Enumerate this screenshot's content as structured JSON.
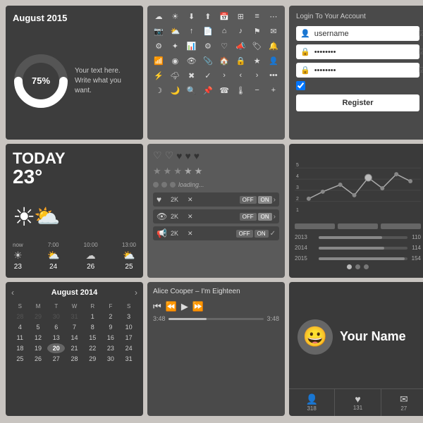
{
  "panel1": {
    "title": "August 2015",
    "donut_percent": 75,
    "donut_label": "75%",
    "sub_text": "Your text here.\nWrite what you want."
  },
  "panel3": {
    "title": "Login To Your Account",
    "username_placeholder": "username",
    "password_placeholder": "········",
    "password2_placeholder": "········",
    "register_label": "Register"
  },
  "panel4": {
    "today_label": "TODAY",
    "temp": "23°",
    "forecast": [
      {
        "time": "now",
        "temp": "23"
      },
      {
        "time": "7:00",
        "temp": "24"
      },
      {
        "time": "10:00",
        "temp": "26"
      },
      {
        "time": "13:00",
        "temp": "25"
      }
    ]
  },
  "panel6": {
    "chart_years": [
      "2013",
      "2014",
      "2015"
    ],
    "chart_vals": [
      110,
      114,
      154
    ],
    "chart_max": 160
  },
  "panel7": {
    "month_label": "August 2014",
    "days_header": [
      "S",
      "M",
      "T",
      "W",
      "R",
      "F",
      "S"
    ],
    "weeks": [
      [
        "28",
        "29",
        "30",
        "31",
        "1",
        "2",
        "3"
      ],
      [
        "4",
        "5",
        "6",
        "7",
        "8",
        "9",
        "10"
      ],
      [
        "11",
        "12",
        "13",
        "14",
        "15",
        "16",
        "17"
      ],
      [
        "18",
        "19",
        "20",
        "21",
        "22",
        "23",
        "24"
      ],
      [
        "25",
        "26",
        "27",
        "28",
        "29",
        "30",
        "31"
      ]
    ],
    "today_day": "20"
  },
  "panel8": {
    "track": "Alice Cooper – I'm Eighteen",
    "time_current": "3:48",
    "time_total": "3:48"
  },
  "panel9": {
    "profile_name": "Your Name",
    "nav_items": [
      {
        "icon": "👤",
        "count": "318"
      },
      {
        "icon": "♥",
        "count": "131"
      },
      {
        "icon": "✉",
        "count": "27"
      }
    ]
  },
  "panel5": {
    "toggle_items": [
      {
        "icon": "♥",
        "count": "2K"
      },
      {
        "icon": "👁",
        "count": "2K"
      },
      {
        "icon": "📢",
        "count": "2K"
      }
    ],
    "loading_label": "loading..."
  }
}
